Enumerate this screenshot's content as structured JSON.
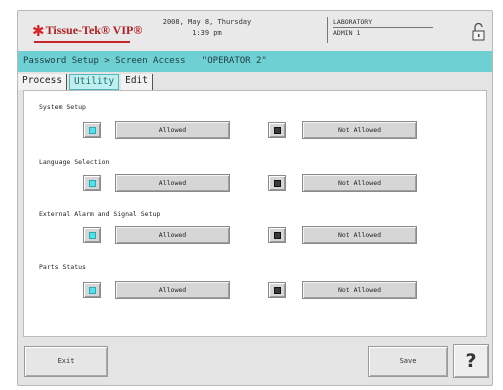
{
  "header": {
    "logo_text": "Tissue-Tek® VIP®",
    "date": "2008, May 8, Thursday",
    "time": "1:39 pm",
    "location": "LABORATORY",
    "user": "ADMIN 1"
  },
  "breadcrumb": "Password Setup > Screen Access   \"OPERATOR 2\"",
  "tabs": [
    "Process",
    "Utility",
    "Edit"
  ],
  "active_tab": "Utility",
  "sections": [
    {
      "label": "System Setup",
      "allowed_label": "Allowed",
      "not_allowed_label": "Not Allowed",
      "selected": "Allowed"
    },
    {
      "label": "Language Selection",
      "allowed_label": "Allowed",
      "not_allowed_label": "Not Allowed",
      "selected": "Allowed"
    },
    {
      "label": "External Alarm and Signal Setup",
      "allowed_label": "Allowed",
      "not_allowed_label": "Not Allowed",
      "selected": "Allowed"
    },
    {
      "label": "Parts Status",
      "allowed_label": "Allowed",
      "not_allowed_label": "Not Allowed",
      "selected": "Allowed"
    }
  ],
  "footer": {
    "exit_label": "Exit",
    "save_label": "Save",
    "help_label": "?"
  },
  "icons": {
    "lock": "unlock-icon",
    "logo": "star-logo-icon"
  },
  "colors": {
    "accent": "#6fd0d3",
    "brand_red": "#c8242a",
    "selected_indicator": "#4fe3ec",
    "unselected_indicator": "#3a3a3a"
  }
}
